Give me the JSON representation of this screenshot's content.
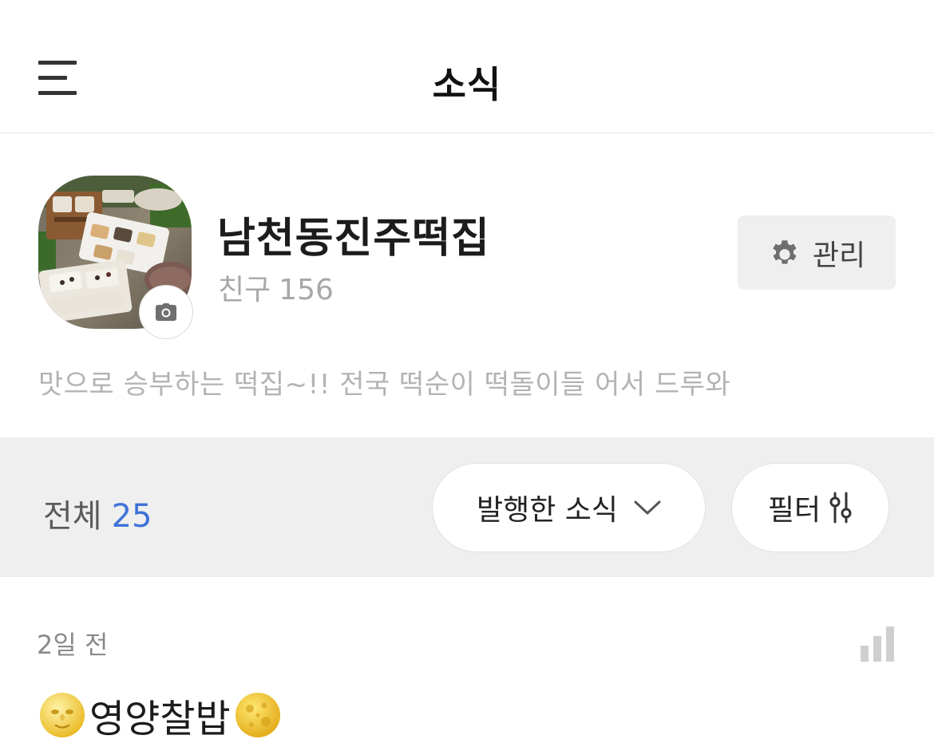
{
  "header": {
    "title": "소식",
    "menu_icon": "hamburger-icon"
  },
  "profile": {
    "name": "남천동진주떡집",
    "friends_label": "친구",
    "friends_count": "156",
    "manage_label": "관리",
    "manage_icon": "gear-icon",
    "intro": "맛으로 승부하는 떡집~!! 전국 떡순이 떡돌이들 어서 드루와",
    "camera_icon": "camera-icon"
  },
  "filter_bar": {
    "total_label": "전체",
    "total_count": "25",
    "published_label": "발행한 소식",
    "filter_label": "필터",
    "accent_color": "#3f72d8"
  },
  "post": {
    "time": "2일 전",
    "title": "영양찰밥",
    "title_emoji_left": "full-moon-face-emoji",
    "title_emoji_right": "full-moon-emoji",
    "stats_icon": "bar-chart-icon"
  }
}
